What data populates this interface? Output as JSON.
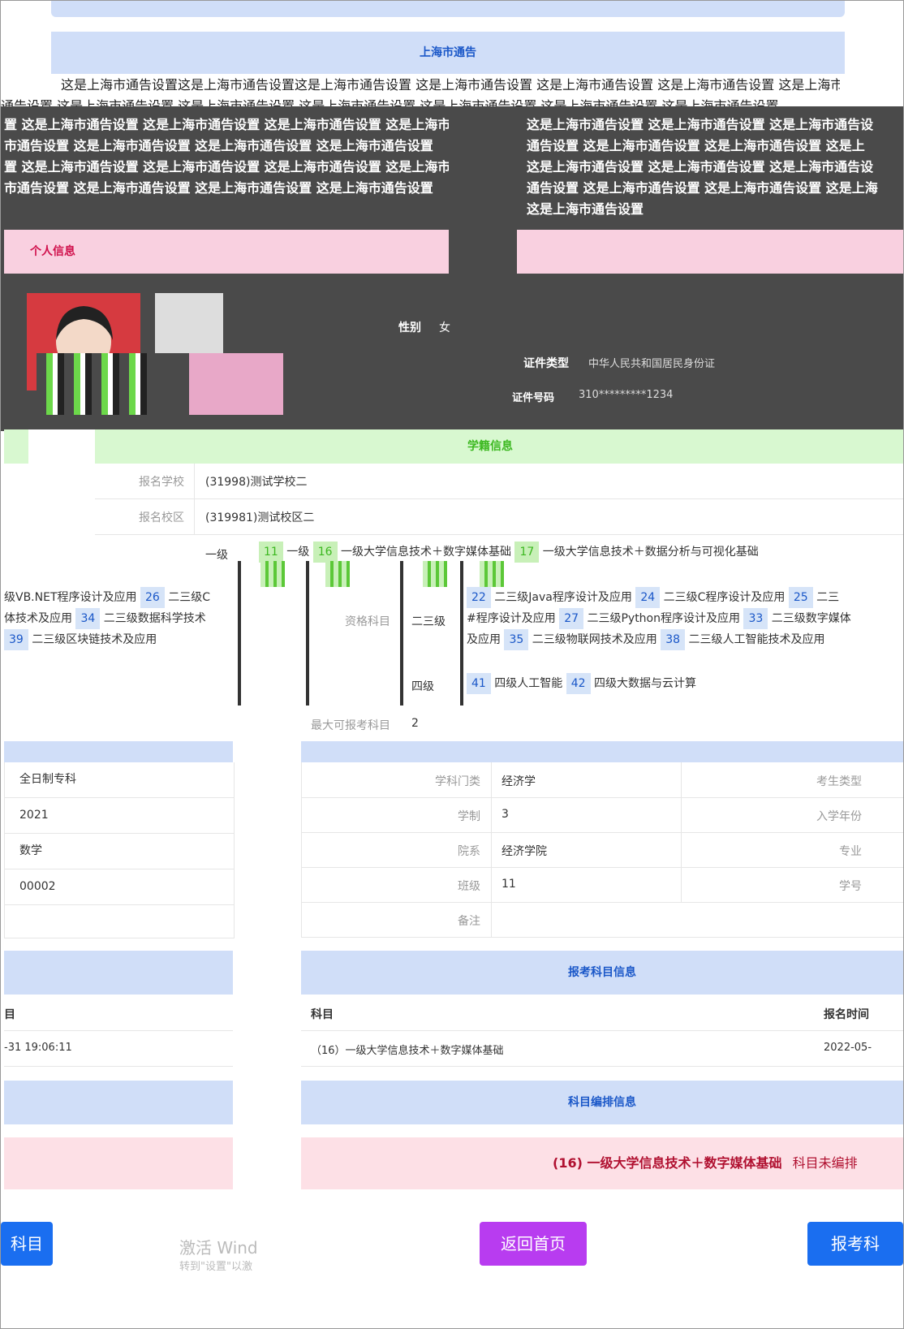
{
  "notice": {
    "title": "上海市通告",
    "line1": "这是上海市通告设置这是上海市通告设置这是上海市通告设置 这是上海市通告设置 这是上海市通告设置 这是上海市通告设置 这是上海市",
    "line2": "通告设置 这是上海市通告设置 这是上海市通告设置 这是上海市通告设置 这是上海市通告设置 这是上海市通告设置 这是上海市通告设置",
    "left_lines": [
      "置 这是上海市通告设置 这是上海市通告设置 这是上海市通告设置 这是上海市",
      "市通告设置 这是上海市通告设置 这是上海市通告设置 这是上海市通告设置",
      "置 这是上海市通告设置 这是上海市通告设置 这是上海市通告设置 这是上海市",
      "市通告设置 这是上海市通告设置 这是上海市通告设置 这是上海市通告设置"
    ],
    "right_lines": [
      "这是上海市通告设置 这是上海市通告设置 这是上海市通告设",
      "通告设置 这是上海市通告设置 这是上海市通告设置 这是上",
      "这是上海市通告设置 这是上海市通告设置 这是上海市通告设",
      "通告设置 这是上海市通告设置 这是上海市通告设置 这是上海",
      "这是上海市通告设置"
    ]
  },
  "personal": {
    "title": "个人信息",
    "gender_label": "性别",
    "gender_value": "女",
    "id_type_label": "证件类型",
    "id_type_value": "中华人民共和国居民身份证",
    "id_no_label": "证件号码",
    "id_no_value": "310*********1234"
  },
  "school": {
    "title": "学籍信息",
    "school_label": "报名学校",
    "school_value": "(31998)测试学校二",
    "campus_label": "报名校区",
    "campus_value": "(319981)测试校区二",
    "level1_label": "一级",
    "level1_tags": [
      {
        "num": "11",
        "name": "一级"
      },
      {
        "num": "16",
        "name": "一级大学信息技术＋数字媒体基础"
      },
      {
        "num": "17",
        "name": "一级大学信息技术＋数据分析与可视化基础"
      }
    ],
    "qual_label": "资格科目",
    "level2_label": "二三级",
    "level2_rows": [
      [
        {
          "num": "22",
          "name": "二三级Java程序设计及应用"
        },
        {
          "num": "24",
          "name": "二三级C程序设计及应用"
        },
        {
          "num": "25",
          "name": "二三"
        }
      ],
      [
        {
          "num": "",
          "name": "#程序设计及应用"
        },
        {
          "num": "27",
          "name": "二三级Python程序设计及应用"
        },
        {
          "num": "33",
          "name": "二三级数字媒体"
        }
      ],
      [
        {
          "num": "",
          "name": "及应用"
        },
        {
          "num": "35",
          "name": "二三级物联网技术及应用"
        },
        {
          "num": "38",
          "name": "二三级人工智能技术及应用"
        }
      ]
    ],
    "left_frag_rows": [
      [
        {
          "num": "",
          "name": "级VB.NET程序设计及应用"
        },
        {
          "num": "26",
          "name": "二三级C"
        }
      ],
      [
        {
          "num": "",
          "name": "体技术及应用"
        },
        {
          "num": "34",
          "name": "二三级数据科学技术"
        }
      ],
      [
        {
          "num": "39",
          "name": "二三级区块链技术及应用"
        }
      ]
    ],
    "level4_label": "四级",
    "level4_tags": [
      {
        "num": "41",
        "name": "四级人工智能"
      },
      {
        "num": "42",
        "name": "四级大数据与云计算"
      }
    ],
    "max_label": "最大可报考科目",
    "max_value": "2"
  },
  "left_table": {
    "rows": [
      "全日制专科",
      "2021",
      "数学",
      "00002"
    ]
  },
  "right_table": {
    "rows": [
      {
        "label": "学科门类",
        "value": "经济学",
        "label2": "考生类型"
      },
      {
        "label": "学制",
        "value": "3",
        "label2": "入学年份"
      },
      {
        "label": "院系",
        "value": "经济学院",
        "label2": "专业"
      },
      {
        "label": "班级",
        "value": "11",
        "label2": "学号"
      },
      {
        "label": "备注",
        "value": "",
        "label2": ""
      }
    ]
  },
  "exam": {
    "title": "报考科目信息",
    "col_subject": "科目",
    "col_time": "报名时间",
    "row_subject": "（16）一级大学信息技术＋数字媒体基础",
    "row_time": "2022-05-",
    "left_frag_head": "目",
    "left_frag_time": "-31 19:06:11"
  },
  "arrange": {
    "title": "科目编排信息",
    "subject": "(16) 一级大学信息技术＋数字媒体基础",
    "status": "科目未编排"
  },
  "buttons": {
    "left": "科目",
    "home": "返回首页",
    "right": "报考科"
  },
  "watermark": {
    "line1": "激活 Wind",
    "line2": "转到\"设置\"以激"
  },
  "colors": {
    "blue_head": "#d0def8",
    "pink_head": "#f9d0e0",
    "green_head": "#d8f8d0",
    "btn_blue": "#1a6ef0",
    "btn_purple": "#b83cf0",
    "arrange_pink": "#fde0e6"
  }
}
